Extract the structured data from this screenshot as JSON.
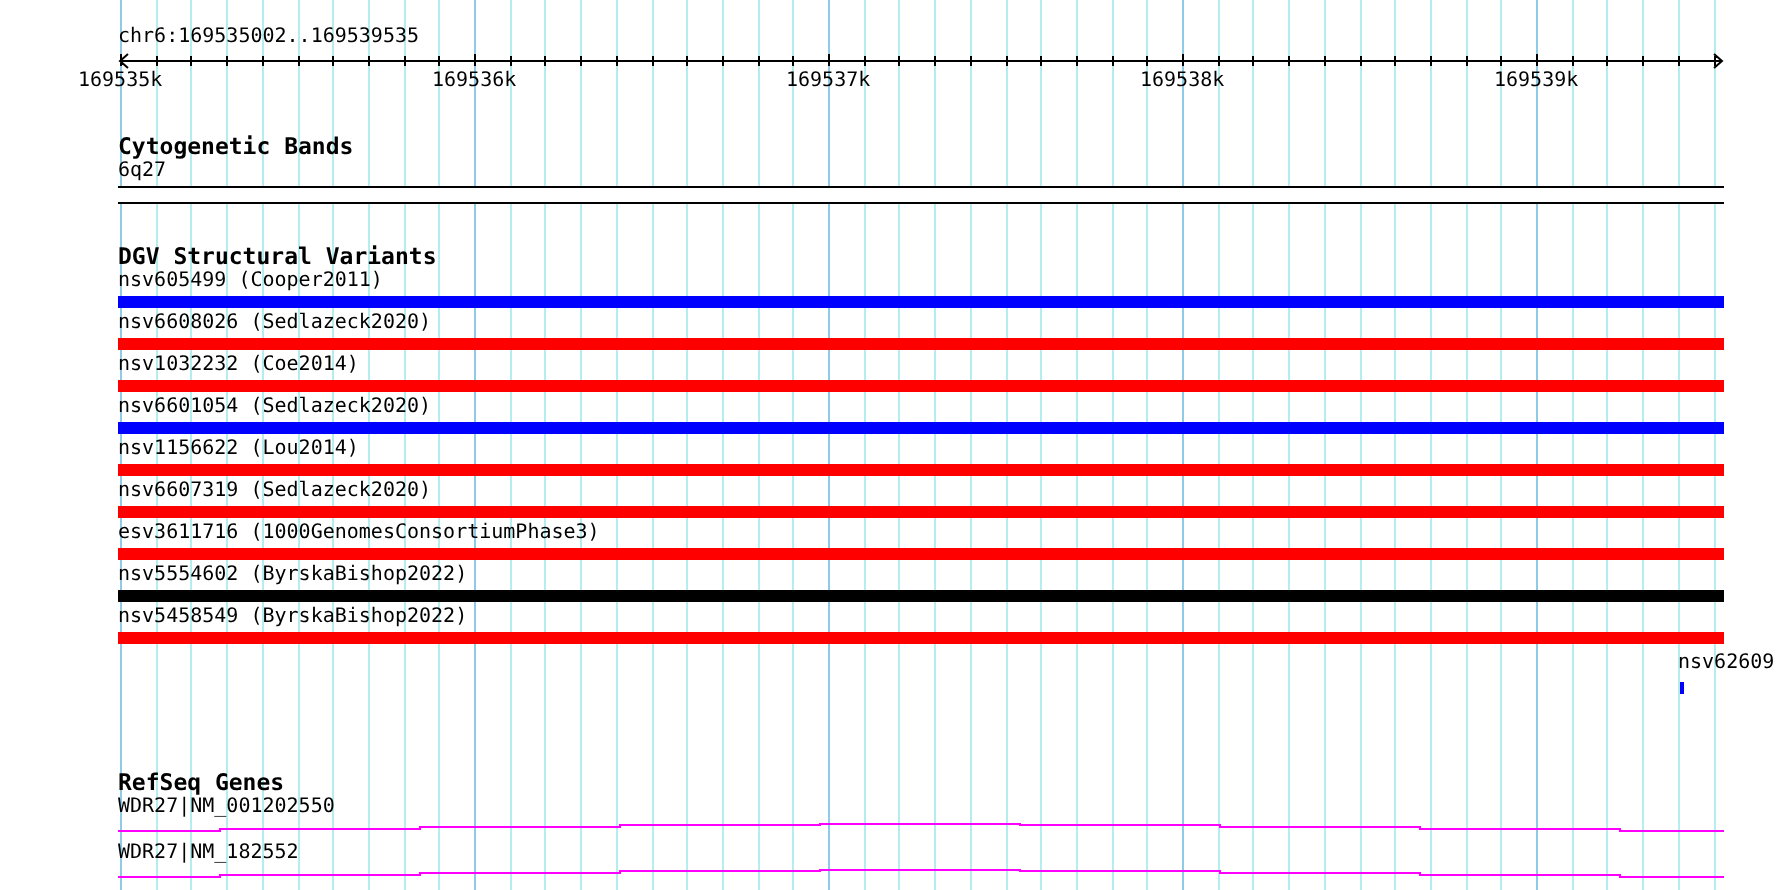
{
  "ruler": {
    "location": "chr6:169535002..169539535",
    "ticks": [
      "169535k",
      "169536k",
      "169537k",
      "169538k",
      "169539k"
    ]
  },
  "cytogenetic_track": {
    "title": "Cytogenetic Bands",
    "features": [
      {
        "label": "6q27"
      }
    ]
  },
  "dgv_track": {
    "title": "DGV Structural Variants",
    "features": [
      {
        "label": "nsv605499 (Cooper2011)",
        "color": "#0000ff"
      },
      {
        "label": "nsv6608026 (Sedlazeck2020)",
        "color": "#ff0000"
      },
      {
        "label": "nsv1032232 (Coe2014)",
        "color": "#ff0000"
      },
      {
        "label": "nsv6601054 (Sedlazeck2020)",
        "color": "#0000ff"
      },
      {
        "label": "nsv1156622 (Lou2014)",
        "color": "#ff0000"
      },
      {
        "label": "nsv6607319 (Sedlazeck2020)",
        "color": "#ff0000"
      },
      {
        "label": "esv3611716 (1000GenomesConsortiumPhase3)",
        "color": "#ff0000"
      },
      {
        "label": "nsv5554602 (ByrskaBishop2022)",
        "color": "#000000"
      },
      {
        "label": "nsv5458549 (ByrskaBishop2022)",
        "color": "#ff0000"
      }
    ],
    "edge_feature": {
      "label": "nsv62609",
      "color": "#0000ff"
    }
  },
  "refseq_track": {
    "title": "RefSeq Genes",
    "features": [
      {
        "label": "WDR27|NM_001202550"
      },
      {
        "label": "WDR27|NM_182552"
      }
    ]
  }
}
